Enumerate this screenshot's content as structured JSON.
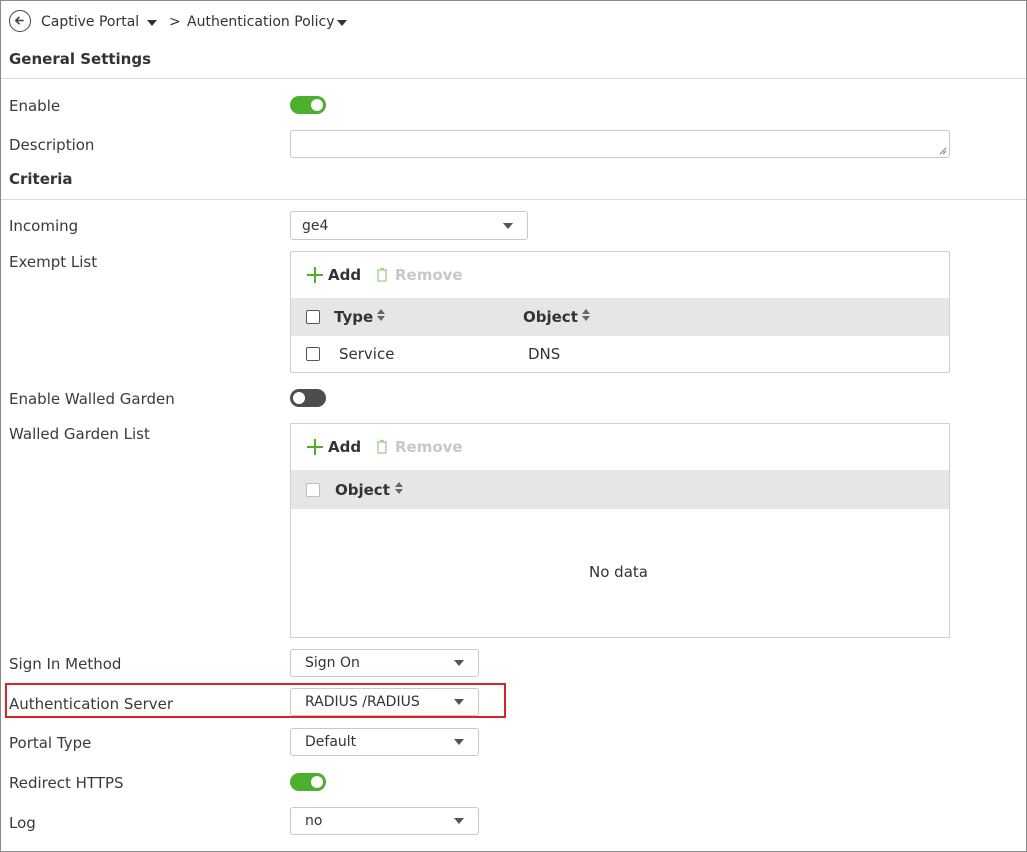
{
  "breadcrumb": {
    "items": [
      {
        "label": "Captive Portal"
      },
      {
        "label": "Authentication Policy"
      }
    ],
    "separator": ">"
  },
  "sections": {
    "general": "General Settings",
    "criteria": "Criteria"
  },
  "fields": {
    "enable": {
      "label": "Enable",
      "value": true
    },
    "description": {
      "label": "Description",
      "value": ""
    },
    "incoming": {
      "label": "Incoming",
      "value": "ge4"
    },
    "exempt_list": {
      "label": "Exempt List"
    },
    "enable_walled_garden": {
      "label": "Enable Walled Garden",
      "value": false
    },
    "walled_garden_list": {
      "label": "Walled Garden List"
    },
    "sign_in_method": {
      "label": "Sign In Method",
      "value": "Sign On"
    },
    "authentication_server": {
      "label": "Authentication Server",
      "value": "RADIUS /RADIUS"
    },
    "portal_type": {
      "label": "Portal Type",
      "value": "Default"
    },
    "redirect_https": {
      "label": "Redirect HTTPS",
      "value": true
    },
    "log": {
      "label": "Log",
      "value": "no"
    }
  },
  "exempt_table": {
    "add_label": "Add",
    "remove_label": "Remove",
    "columns": [
      "Type",
      "Object"
    ],
    "rows": [
      {
        "type": "Service",
        "object": "DNS"
      }
    ]
  },
  "walled_table": {
    "add_label": "Add",
    "remove_label": "Remove",
    "columns": [
      "Object"
    ],
    "empty_text": "No data"
  },
  "colors": {
    "accent_green": "#4caf2e",
    "toggle_off": "#4d4d4d",
    "highlight_red": "#d8232a",
    "header_gray": "#e6e6e6"
  },
  "icons": {
    "back": "arrow-left-circle-icon",
    "dropdown": "caret-down-icon",
    "add": "plus-icon",
    "remove": "trash-icon",
    "sort": "sort-icon"
  }
}
